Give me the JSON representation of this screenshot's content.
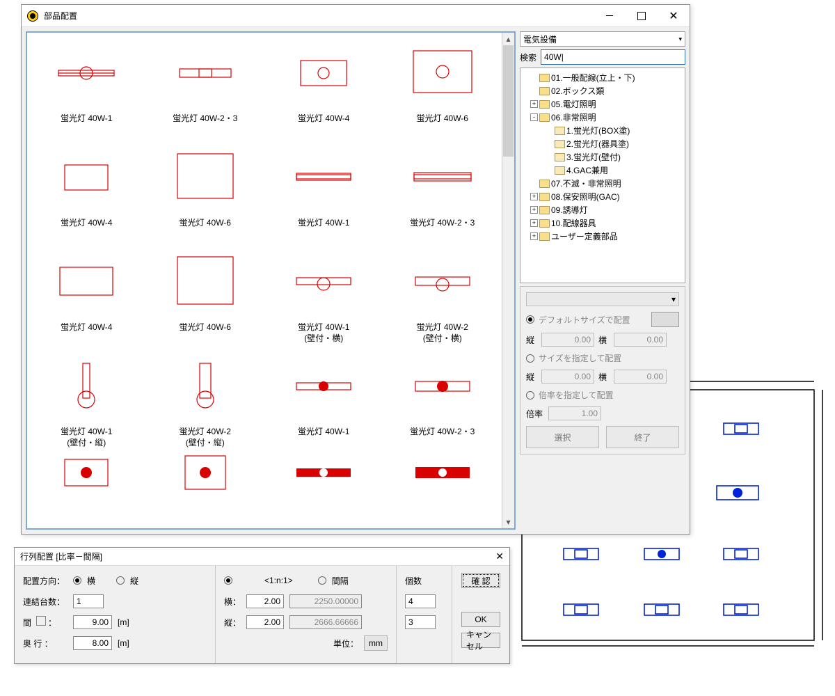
{
  "main_window": {
    "title": "部品配置",
    "palette": {
      "rows": [
        [
          {
            "label": "蛍光灯 40W-1",
            "sub": ""
          },
          {
            "label": "蛍光灯 40W-2・3",
            "sub": ""
          },
          {
            "label": "蛍光灯 40W-4",
            "sub": ""
          },
          {
            "label": "蛍光灯 40W-6",
            "sub": ""
          }
        ],
        [
          {
            "label": "蛍光灯 40W-4",
            "sub": ""
          },
          {
            "label": "蛍光灯 40W-6",
            "sub": ""
          },
          {
            "label": "蛍光灯 40W-1",
            "sub": ""
          },
          {
            "label": "蛍光灯 40W-2・3",
            "sub": ""
          }
        ],
        [
          {
            "label": "蛍光灯 40W-4",
            "sub": ""
          },
          {
            "label": "蛍光灯 40W-6",
            "sub": ""
          },
          {
            "label": "蛍光灯 40W-1",
            "sub": "(壁付・横)"
          },
          {
            "label": "蛍光灯 40W-2",
            "sub": "(壁付・横)"
          }
        ],
        [
          {
            "label": "蛍光灯 40W-1",
            "sub": "(壁付・縦)"
          },
          {
            "label": "蛍光灯 40W-2",
            "sub": "(壁付・縦)"
          },
          {
            "label": "蛍光灯 40W-1",
            "sub": ""
          },
          {
            "label": "蛍光灯 40W-2・3",
            "sub": ""
          }
        ],
        [
          {
            "label": "",
            "sub": ""
          },
          {
            "label": "",
            "sub": ""
          },
          {
            "label": "",
            "sub": ""
          },
          {
            "label": "",
            "sub": ""
          }
        ]
      ]
    },
    "right": {
      "category": "電気設備",
      "search_label": "検索",
      "search_value": "40W|",
      "tree": [
        {
          "indent": 0,
          "exp": " ",
          "name": "01.一般配線(立上・下)"
        },
        {
          "indent": 0,
          "exp": " ",
          "name": "02.ボックス類"
        },
        {
          "indent": 0,
          "exp": "+",
          "name": "05.電灯照明"
        },
        {
          "indent": 0,
          "exp": "-",
          "name": "06.非常照明"
        },
        {
          "indent": 1,
          "exp": " ",
          "open": true,
          "name": "1.蛍光灯(BOX塗)"
        },
        {
          "indent": 1,
          "exp": " ",
          "open": true,
          "name": "2.蛍光灯(器具塗)"
        },
        {
          "indent": 1,
          "exp": " ",
          "open": true,
          "name": "3.蛍光灯(壁付)"
        },
        {
          "indent": 1,
          "exp": " ",
          "open": true,
          "name": "4.GAC兼用"
        },
        {
          "indent": 0,
          "exp": " ",
          "name": "07.不滅・非常照明"
        },
        {
          "indent": 0,
          "exp": "+",
          "name": "08.保安照明(GAC)"
        },
        {
          "indent": 0,
          "exp": "+",
          "name": "09.誘導灯"
        },
        {
          "indent": 0,
          "exp": "+",
          "name": "10.配線器具"
        },
        {
          "indent": 0,
          "exp": "+",
          "name": "ユーザー定義部品"
        }
      ],
      "opt_default": "デフォルトサイズで配置",
      "opt_size": "サイズを指定して配置",
      "opt_scale": "倍率を指定して配置",
      "v_label": "縦",
      "h_label": "横",
      "scale_label": "倍率",
      "v1": "0.00",
      "h1": "0.00",
      "v2": "0.00",
      "h2": "0.00",
      "scale": "1.00",
      "btn_select": "選択",
      "btn_close": "終了"
    }
  },
  "matrix_window": {
    "title": "行列配置 [比率－間隔]",
    "dir_label": "配置方向：",
    "dir_h": "横",
    "dir_v": "縦",
    "count_label": "連結台数：",
    "count_value": "1",
    "span_label": "間",
    "span_value": "9.00",
    "depth_label": "奥  行",
    "depth_value": "8.00",
    "unit_m": "[m]",
    "ratio_label": "<1:n:1>",
    "gap_label": "間隔",
    "h_label": "横：",
    "v_label": "縦：",
    "h_val": "2.00",
    "v_val": "2.00",
    "h_calc": "2250.00000",
    "v_calc": "2666.66666",
    "unit_label": "単位：",
    "unit_btn": "mm",
    "qty_label": "個数",
    "qty_h": "4",
    "qty_v": "3",
    "confirm": "確 認",
    "ok": "OK",
    "cancel": "キャンセル"
  }
}
